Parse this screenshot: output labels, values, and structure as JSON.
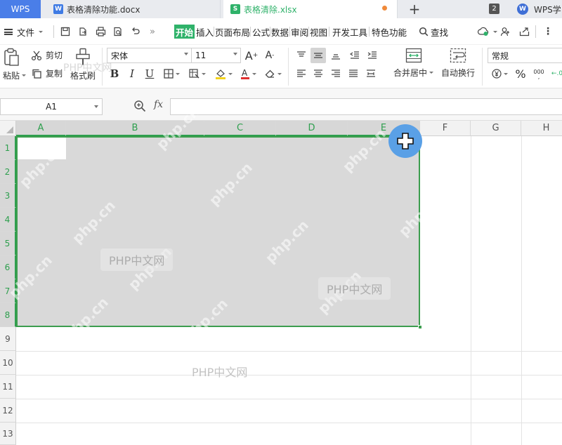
{
  "tabbar": {
    "home": "WPS",
    "tabs": [
      {
        "icon": "W",
        "name": "表格清除功能.docx"
      },
      {
        "icon": "S",
        "name": "表格清除.xlsx"
      }
    ],
    "window_count": "2",
    "wps_learn": "WPS学"
  },
  "menubar": {
    "file": "文件",
    "tabs": [
      "开始",
      "插入",
      "页面布局",
      "公式",
      "数据",
      "审阅",
      "视图",
      "开发工具",
      "特色功能"
    ],
    "search": "查找"
  },
  "ribbon": {
    "paste": "粘贴",
    "cut": "剪切",
    "copy": "复制",
    "format_painter": "格式刷",
    "font_name": "宋体",
    "font_size": "11",
    "merge_center": "合并居中",
    "wrap_text": "自动换行",
    "number_format": "常规",
    "percent": "%",
    "thousands": "000"
  },
  "formulabar": {
    "cell_ref": "A1",
    "fx": "fx",
    "value": ""
  },
  "grid": {
    "columns": [
      "A",
      "B",
      "C",
      "D",
      "E",
      "F",
      "G",
      "H"
    ],
    "rows": [
      "1",
      "2",
      "3",
      "4",
      "5",
      "6",
      "7",
      "8",
      "9",
      "10",
      "11",
      "12",
      "13"
    ],
    "selection": "A1:E8"
  },
  "watermark": {
    "domain": "php.cn",
    "label": "PHP中文网"
  },
  "colors": {
    "accent_green": "#2fb26a",
    "selection_border": "#3c9d4e",
    "selection_fill": "#d9d9d9",
    "wps_blue": "#4a7ee8"
  }
}
